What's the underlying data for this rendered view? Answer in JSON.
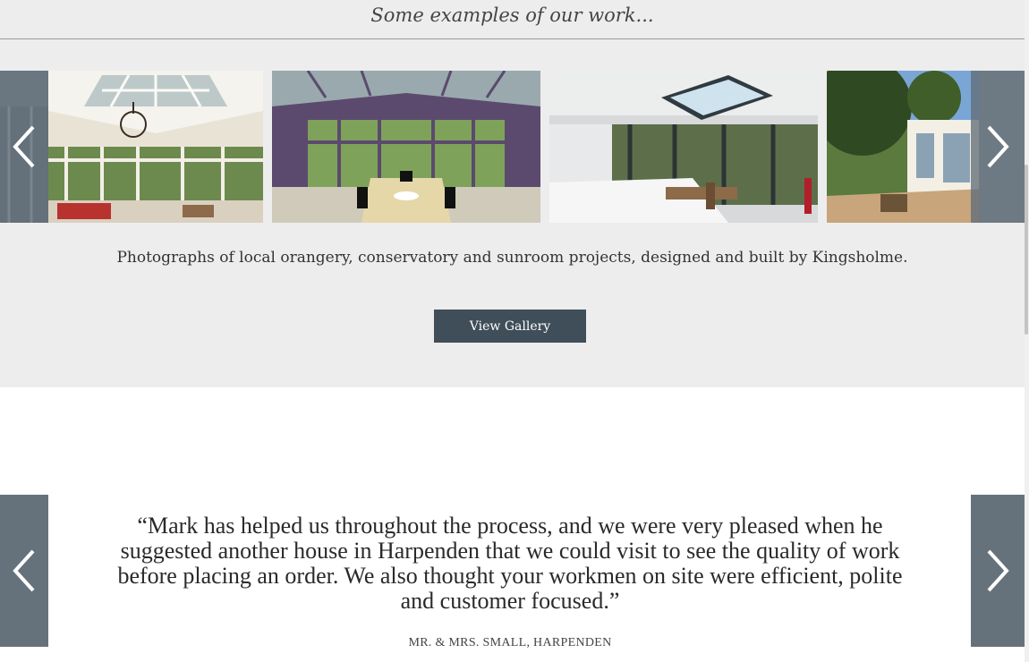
{
  "gallery": {
    "heading": "Some examples of our work...",
    "caption": "Photographs of local orangery, conservatory and sunroom projects, designed and built by Kingsholme.",
    "view_gallery_label": "View Gallery",
    "prev_icon": "chevron-left-icon",
    "next_icon": "chevron-right-icon"
  },
  "testimonial": {
    "quote": "“Mark has helped us throughout the process, and we were very pleased when he suggested another house in Harpenden that we could visit to see the quality of work before placing an order. We also thought your workmen on site were efficient, polite and customer focused.”",
    "author": "MR. & MRS. SMALL, HARPENDEN"
  },
  "colors": {
    "section_bg": "#ededed",
    "button_bg": "#3f4e59",
    "arrow_bg": "#66727b"
  }
}
